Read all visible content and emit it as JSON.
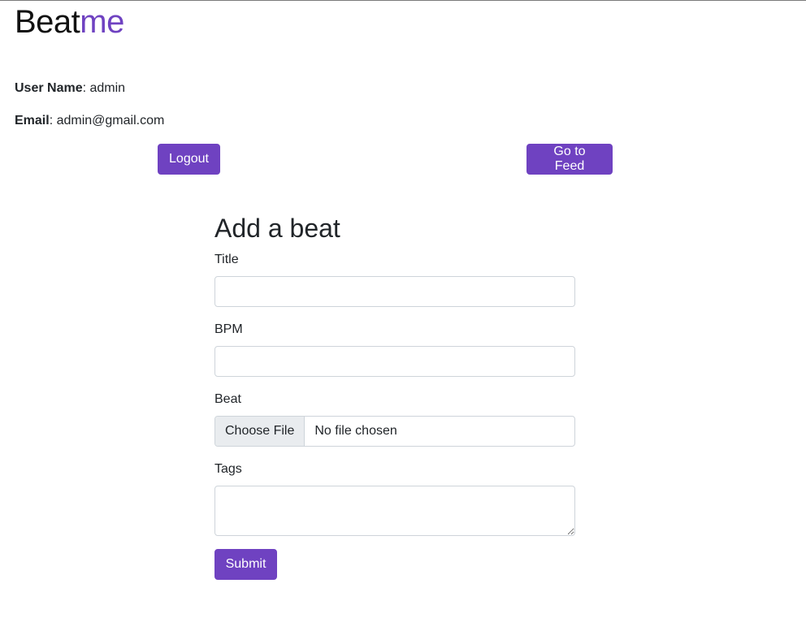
{
  "brand": {
    "part1": "Beat",
    "part2": "me"
  },
  "user": {
    "name_label": "User Name",
    "name_value": ": admin",
    "email_label": "Email",
    "email_value": ": admin@gmail.com"
  },
  "actions": {
    "logout": "Logout",
    "feed": "Go to Feed"
  },
  "form": {
    "heading": "Add a beat",
    "title_label": "Title",
    "title_value": "",
    "bpm_label": "BPM",
    "bpm_value": "",
    "beat_label": "Beat",
    "file_button": "Choose File",
    "file_status": "No file chosen",
    "tags_label": "Tags",
    "tags_value": "",
    "submit": "Submit"
  },
  "colors": {
    "accent": "#6f42c1"
  }
}
